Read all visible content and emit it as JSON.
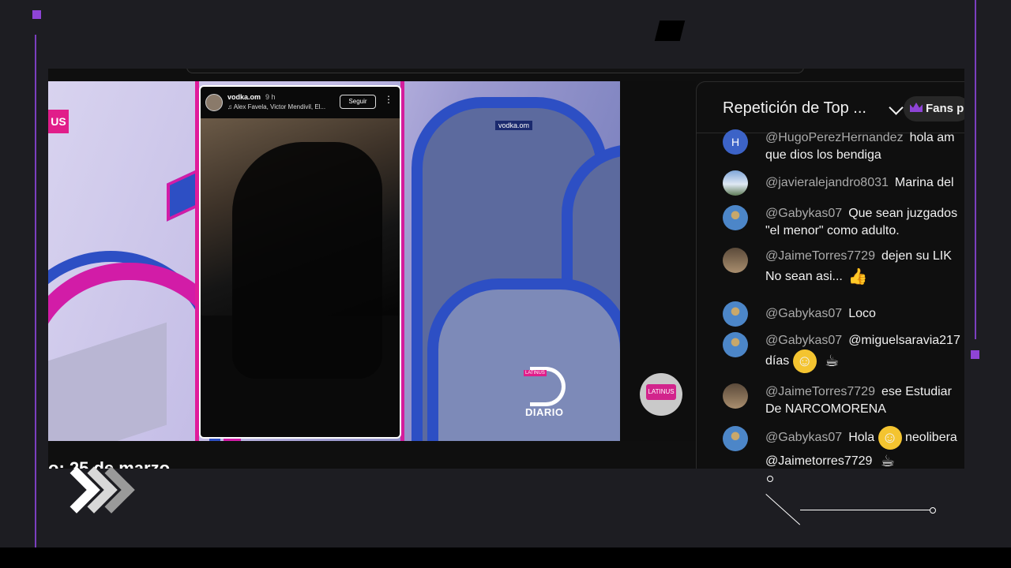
{
  "story": {
    "username": "vodka.om",
    "time": "9 h",
    "music": "♫ Alex Favela, Victor Mendivil, El...",
    "follow_label": "Seguir",
    "more_icon": "more-vertical-icon"
  },
  "video": {
    "us_tag": "US",
    "watermark": "vodka.om",
    "diario_badge": "LATINUS",
    "diario_text": "DIARIO",
    "channel_logo_text": "LATINUS",
    "date_text": "o: 25 de marzo"
  },
  "chat": {
    "title": "Repetición de Top ...",
    "fans_label": "Fans p",
    "messages": [
      {
        "author": "@HugoPerezHernandez",
        "text": "hola am",
        "line2": "que dios los bendiga",
        "avatar": "H"
      },
      {
        "author": "@javieralejandro8031",
        "text": "Marina del",
        "line2": "",
        "avatar": ""
      },
      {
        "author": "@Gabykas07",
        "text": "Que sean juzgados",
        "line2": "\"el menor\" como adulto.",
        "avatar": ""
      },
      {
        "author": "@JaimeTorres7729",
        "text": "dejen su LIK",
        "line2": "No sean asi...",
        "avatar": ""
      },
      {
        "author": "@Gabykas07",
        "text": "Loco",
        "line2": "",
        "avatar": ""
      },
      {
        "author": "@Gabykas07",
        "text": "@miguelsaravia217",
        "line2": "días",
        "avatar": ""
      },
      {
        "author": "@JaimeTorres7729",
        "text": "ese Estudiar",
        "line2": "De NARCOMORENA",
        "avatar": ""
      },
      {
        "author": "@Gabykas07",
        "text": "Hola",
        "text_after": "neolibera",
        "line2": "@Jaimetorres7729",
        "avatar": ""
      }
    ]
  },
  "colors": {
    "accent_purple": "#8e44d6",
    "pink": "#e11d8a",
    "chat_bg": "#0f0f0f"
  }
}
